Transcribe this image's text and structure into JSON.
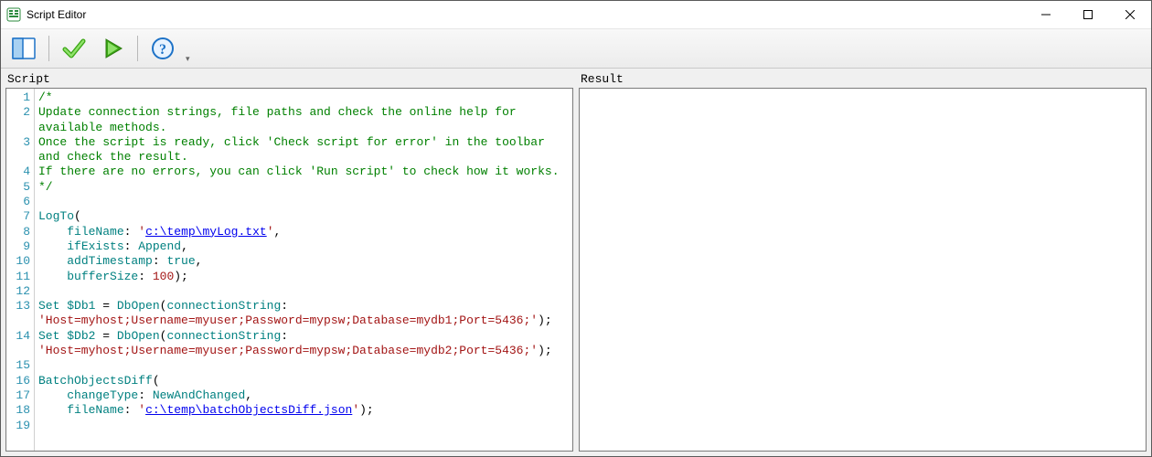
{
  "window": {
    "title": "Script Editor"
  },
  "panes": {
    "script_label": "Script",
    "result_label": "Result"
  },
  "toolbar": {
    "layout_tooltip": "Layout",
    "check_tooltip": "Check script for error",
    "run_tooltip": "Run script",
    "help_tooltip": "Help"
  },
  "code": {
    "lines": [
      {
        "n": "1",
        "seg": [
          {
            "t": "/*",
            "cls": "c-comment"
          }
        ]
      },
      {
        "n": "2",
        "seg": [
          {
            "t": "Update connection strings, file paths and check the online help for available methods.",
            "cls": "c-comment"
          }
        ]
      },
      {
        "n": "3",
        "seg": [
          {
            "t": "Once the script is ready, click 'Check script for error' in the toolbar and check the result.",
            "cls": "c-comment"
          }
        ]
      },
      {
        "n": "4",
        "seg": [
          {
            "t": "If there are no errors, you can click 'Run script' to check how it works.",
            "cls": "c-comment"
          }
        ]
      },
      {
        "n": "5",
        "seg": [
          {
            "t": "*/",
            "cls": "c-comment"
          }
        ]
      },
      {
        "n": "6",
        "seg": [
          {
            "t": "",
            "cls": ""
          }
        ]
      },
      {
        "n": "7",
        "seg": [
          {
            "t": "LogTo",
            "cls": "c-kw"
          },
          {
            "t": "(",
            "cls": "c-op"
          }
        ]
      },
      {
        "n": "8",
        "seg": [
          {
            "t": "    ",
            "cls": ""
          },
          {
            "t": "fileName",
            "cls": "c-param"
          },
          {
            "t": ": ",
            "cls": "c-op"
          },
          {
            "t": "'",
            "cls": "c-str"
          },
          {
            "t": "c:\\temp\\myLog.txt",
            "cls": "c-str c-link"
          },
          {
            "t": "'",
            "cls": "c-str"
          },
          {
            "t": ",",
            "cls": "c-op"
          }
        ]
      },
      {
        "n": "9",
        "seg": [
          {
            "t": "    ",
            "cls": ""
          },
          {
            "t": "ifExists",
            "cls": "c-param"
          },
          {
            "t": ": ",
            "cls": "c-op"
          },
          {
            "t": "Append",
            "cls": "c-val"
          },
          {
            "t": ",",
            "cls": "c-op"
          }
        ]
      },
      {
        "n": "10",
        "seg": [
          {
            "t": "    ",
            "cls": ""
          },
          {
            "t": "addTimestamp",
            "cls": "c-param"
          },
          {
            "t": ": ",
            "cls": "c-op"
          },
          {
            "t": "true",
            "cls": "c-val"
          },
          {
            "t": ",",
            "cls": "c-op"
          }
        ]
      },
      {
        "n": "11",
        "seg": [
          {
            "t": "    ",
            "cls": ""
          },
          {
            "t": "bufferSize",
            "cls": "c-param"
          },
          {
            "t": ": ",
            "cls": "c-op"
          },
          {
            "t": "100",
            "cls": "c-num"
          },
          {
            "t": ");",
            "cls": "c-op"
          }
        ]
      },
      {
        "n": "12",
        "seg": [
          {
            "t": "",
            "cls": ""
          }
        ]
      },
      {
        "n": "13",
        "seg": [
          {
            "t": "Set",
            "cls": "c-kw"
          },
          {
            "t": " ",
            "cls": ""
          },
          {
            "t": "$Db1",
            "cls": "c-var"
          },
          {
            "t": " = ",
            "cls": "c-op"
          },
          {
            "t": "DbOpen",
            "cls": "c-kw"
          },
          {
            "t": "(",
            "cls": "c-op"
          },
          {
            "t": "connectionString",
            "cls": "c-param"
          },
          {
            "t": ": ",
            "cls": "c-op"
          },
          {
            "t": "'Host=myhost;Username=myuser;Password=mypsw;Database=mydb1;Port=5436;'",
            "cls": "c-str"
          },
          {
            "t": ");",
            "cls": "c-op"
          }
        ]
      },
      {
        "n": "14",
        "seg": [
          {
            "t": "Set",
            "cls": "c-kw"
          },
          {
            "t": " ",
            "cls": ""
          },
          {
            "t": "$Db2",
            "cls": "c-var"
          },
          {
            "t": " = ",
            "cls": "c-op"
          },
          {
            "t": "DbOpen",
            "cls": "c-kw"
          },
          {
            "t": "(",
            "cls": "c-op"
          },
          {
            "t": "connectionString",
            "cls": "c-param"
          },
          {
            "t": ": ",
            "cls": "c-op"
          },
          {
            "t": "'Host=myhost;Username=myuser;Password=mypsw;Database=mydb2;Port=5436;'",
            "cls": "c-str"
          },
          {
            "t": ");",
            "cls": "c-op"
          }
        ]
      },
      {
        "n": "15",
        "seg": [
          {
            "t": "",
            "cls": ""
          }
        ]
      },
      {
        "n": "16",
        "seg": [
          {
            "t": "BatchObjectsDiff",
            "cls": "c-kw"
          },
          {
            "t": "(",
            "cls": "c-op"
          }
        ]
      },
      {
        "n": "17",
        "seg": [
          {
            "t": "    ",
            "cls": ""
          },
          {
            "t": "changeType",
            "cls": "c-param"
          },
          {
            "t": ": ",
            "cls": "c-op"
          },
          {
            "t": "NewAndChanged",
            "cls": "c-val"
          },
          {
            "t": ",",
            "cls": "c-op"
          }
        ]
      },
      {
        "n": "18",
        "seg": [
          {
            "t": "    ",
            "cls": ""
          },
          {
            "t": "fileName",
            "cls": "c-param"
          },
          {
            "t": ": ",
            "cls": "c-op"
          },
          {
            "t": "'",
            "cls": "c-str"
          },
          {
            "t": "c:\\temp\\batchObjectsDiff.json",
            "cls": "c-str c-link"
          },
          {
            "t": "'",
            "cls": "c-str"
          },
          {
            "t": ");",
            "cls": "c-op"
          }
        ]
      },
      {
        "n": "19",
        "seg": [
          {
            "t": "",
            "cls": ""
          }
        ]
      }
    ],
    "wrap_after": {
      "2": 1,
      "3": 1,
      "13": 1,
      "14": 1
    }
  }
}
